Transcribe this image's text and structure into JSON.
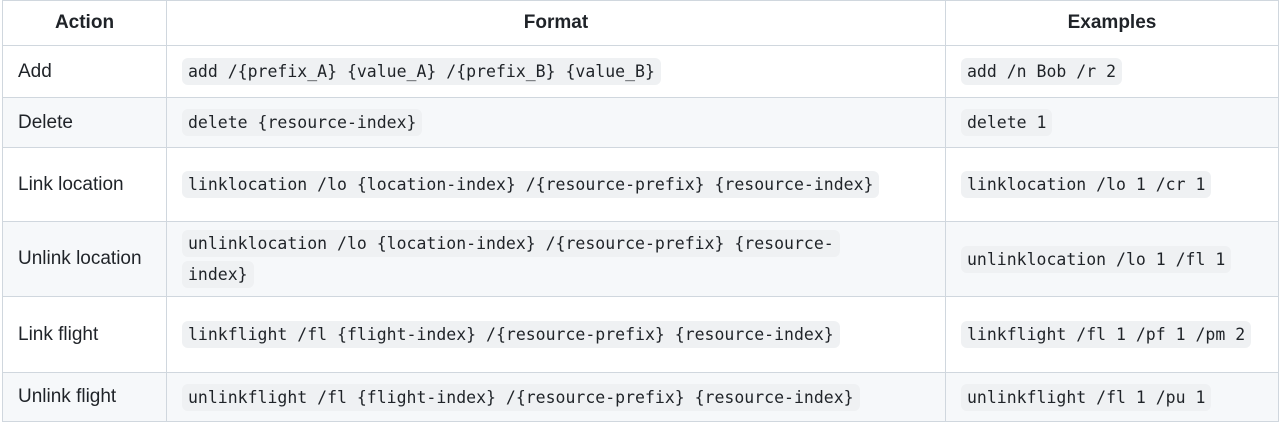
{
  "table": {
    "headers": {
      "action": "Action",
      "format": "Format",
      "examples": "Examples"
    },
    "rows": [
      {
        "action": "Add",
        "format": "add /{prefix_A} {value_A} /{prefix_B} {value_B}",
        "example": "add /n Bob /r 2"
      },
      {
        "action": "Delete",
        "format": "delete {resource-index}",
        "example": "delete 1"
      },
      {
        "action": "Link location",
        "format": "linklocation /lo {location-index} /{resource-prefix} {resource-index}",
        "example": "linklocation /lo 1 /cr 1"
      },
      {
        "action": "Unlink location",
        "format": "unlinklocation /lo {location-index} /{resource-prefix} {resource-index}",
        "example": "unlinklocation /lo 1 /fl 1"
      },
      {
        "action": "Link flight",
        "format": "linkflight /fl {flight-index} /{resource-prefix} {resource-index}",
        "example": "linkflight /fl 1 /pf 1 /pm 2"
      },
      {
        "action": "Unlink flight",
        "format": "unlinkflight /fl {flight-index} /{resource-prefix} {resource-index}",
        "example": "unlinkflight /fl 1 /pu 1"
      }
    ]
  }
}
